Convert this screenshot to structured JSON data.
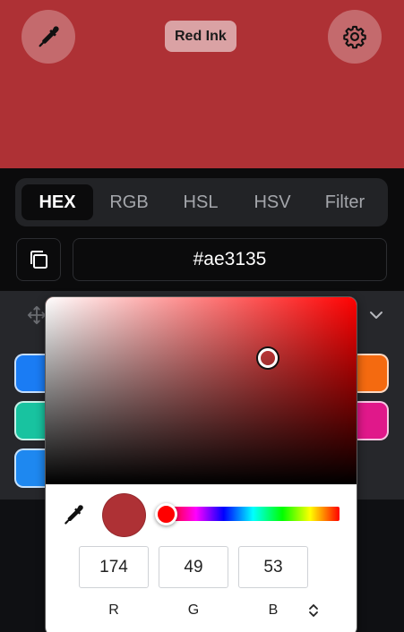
{
  "color": {
    "hex_value": "#ae3135",
    "name": "Red Ink",
    "swatch": "#ae3135",
    "hue_color": "#ff0000",
    "hue_fraction": 0.0,
    "saturation_fraction": 0.72,
    "value_fraction": 0.68
  },
  "header": {
    "eyedropper_icon": "eyedropper-icon",
    "settings_icon": "gear-icon"
  },
  "tabs": [
    {
      "label": "HEX",
      "active": true
    },
    {
      "label": "RGB",
      "active": false
    },
    {
      "label": "HSL",
      "active": false
    },
    {
      "label": "HSV",
      "active": false
    },
    {
      "label": "Filter",
      "active": false
    }
  ],
  "palette": {
    "left_swatches": [
      "#1a7cf4",
      "#18c3a0",
      "#1e88f0"
    ],
    "right_swatches": [
      "#f46a10",
      "#e0188a"
    ]
  },
  "picker": {
    "rgb": {
      "r": "174",
      "g": "49",
      "b": "53"
    },
    "labels": {
      "r": "R",
      "g": "G",
      "b": "B"
    }
  }
}
